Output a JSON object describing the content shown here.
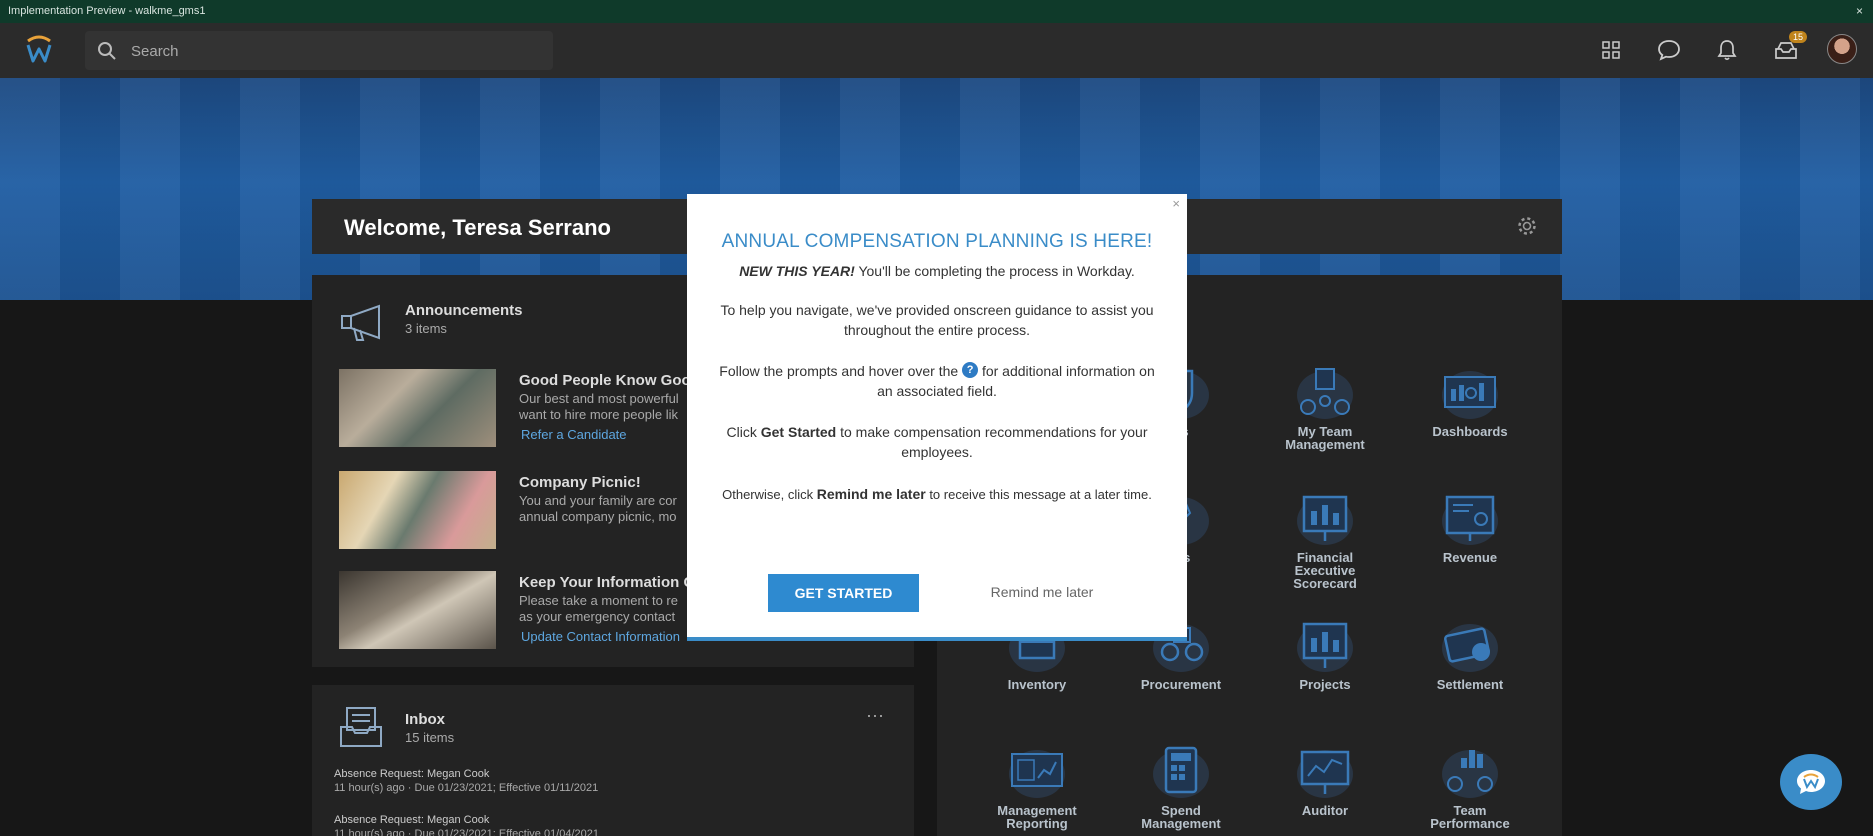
{
  "window": {
    "title": "Implementation Preview - walkme_gms1",
    "close_glyph": "×"
  },
  "header": {
    "search_placeholder": "Search",
    "inbox_badge": "15"
  },
  "welcome": {
    "title": "Welcome, Teresa Serrano"
  },
  "announcements": {
    "title": "Announcements",
    "subtitle": "3 items",
    "items": [
      {
        "heading": "Good People Know Good",
        "description": "Our best and most powerful\nwant to hire more people lik",
        "link": "Refer a Candidate"
      },
      {
        "heading": "Company Picnic!",
        "description": "You and your family are cor\nannual company picnic, mo",
        "link": ""
      },
      {
        "heading": "Keep Your Information C",
        "description": "Please take a moment to re\nas your emergency contact",
        "link": "Update Contact Information"
      }
    ]
  },
  "inbox": {
    "title": "Inbox",
    "subtitle": "15 items",
    "more_glyph": "···",
    "items": [
      {
        "title": "Absence Request: Megan Cook",
        "meta": "11 hour(s) ago · Due 01/23/2021; Effective 01/11/2021"
      },
      {
        "title": "Absence Request: Megan Cook",
        "meta": "11 hour(s) ago · Due 01/23/2021; Effective 01/04/2021"
      }
    ]
  },
  "apps": [
    {
      "label": "",
      "icon": "hidden-app-icon"
    },
    {
      "label": "its",
      "icon": "shield-icon"
    },
    {
      "label": "My Team\nManagement",
      "icon": "team-icon"
    },
    {
      "label": "Dashboards",
      "icon": "dashboard-icon"
    },
    {
      "label": "",
      "icon": "hidden-app-icon"
    },
    {
      "label": "tes",
      "icon": "certificate-icon"
    },
    {
      "label": "Financial\nExecutive\nScorecard",
      "icon": "bar-chart-icon"
    },
    {
      "label": "Revenue",
      "icon": "revenue-icon"
    },
    {
      "label": "Inventory",
      "icon": "inventory-icon"
    },
    {
      "label": "Procurement",
      "icon": "procurement-icon"
    },
    {
      "label": "Projects",
      "icon": "projects-icon"
    },
    {
      "label": "Settlement",
      "icon": "settlement-icon"
    },
    {
      "label": "Management\nReporting",
      "icon": "reporting-icon"
    },
    {
      "label": "Spend\nManagement",
      "icon": "calculator-icon"
    },
    {
      "label": "Auditor",
      "icon": "auditor-icon"
    },
    {
      "label": "Team\nPerformance",
      "icon": "team-performance-icon"
    }
  ],
  "modal": {
    "close_glyph": "×",
    "title": "ANNUAL COMPENSATION PLANNING IS HERE!",
    "p1_bold": "NEW THIS YEAR!",
    "p1_rest": " You'll be completing the process in Workday.",
    "p2": "To help you navigate, we've provided onscreen guidance to assist you throughout the entire process.",
    "p3_pre": "Follow the prompts and hover over the ",
    "p3_q": "?",
    "p3_post": " for additional information on an associated field.",
    "p4_pre": "Click ",
    "p4_bold": "Get Started",
    "p4_post": " to make compensation recommendations for your employees.",
    "p5_pre": "Otherwise, click ",
    "p5_bold": "Remind me later",
    "p5_post": " to receive this message at a later time.",
    "primary_button": "GET STARTED",
    "secondary_button": "Remind me later"
  },
  "colors": {
    "accent": "#3a8cc8",
    "header": "#2b2b2b",
    "strip": "#0f3a2a"
  }
}
